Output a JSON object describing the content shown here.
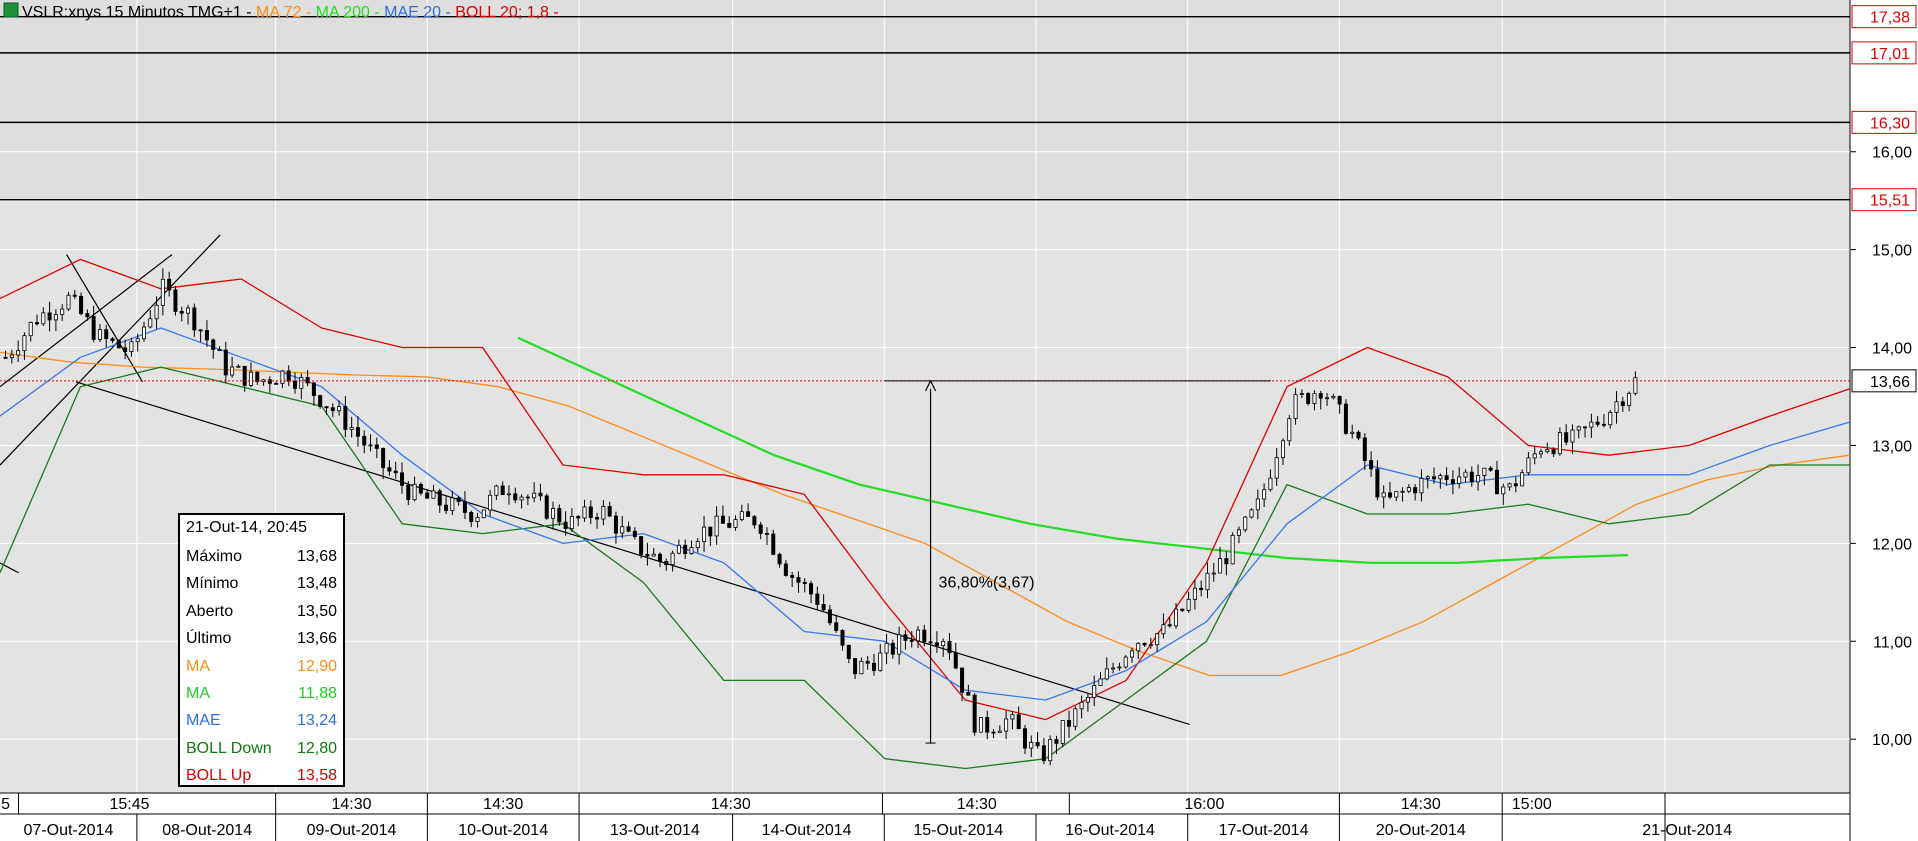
{
  "chart_data": {
    "type": "candlestick",
    "header": {
      "symbol": "VSLR:xnys 15 Minutos TMG+1",
      "separator": "-",
      "indicators": [
        {
          "label": "MA 72",
          "color": "#ff8c1a"
        },
        {
          "label": "MA 200",
          "color": "#22dd22"
        },
        {
          "label": "MAE 20",
          "color": "#2f6fe6"
        },
        {
          "label": "BOLL 20; 1,8",
          "color": "#e00000"
        }
      ]
    },
    "ylim": [
      9.45,
      17.55
    ],
    "y_ticks": [
      "10,00",
      "11,00",
      "12,00",
      "13,00",
      "14,00",
      "15,00",
      "16,00"
    ],
    "level_lines": [
      {
        "value": 17.38,
        "label": "17,38"
      },
      {
        "value": 17.01,
        "label": "17,01"
      },
      {
        "value": 16.3,
        "label": "16,30"
      },
      {
        "value": 15.51,
        "label": "15,51"
      }
    ],
    "current_price": {
      "value": 13.66,
      "label": "13,66",
      "color": "#e00000"
    },
    "x_time_labels": [
      {
        "slot": 0,
        "label": "5"
      },
      {
        "slot": 1,
        "label": "15:45"
      },
      {
        "slot": 2,
        "label": "14:30"
      },
      {
        "slot": 3,
        "label": "14:30"
      },
      {
        "slot": 4,
        "label": "14:30"
      },
      {
        "slot": 5,
        "label": "14:30"
      },
      {
        "slot": 6,
        "label": "16:00"
      },
      {
        "slot": 7,
        "label": "14:30"
      },
      {
        "slot": 8,
        "label": "15:00"
      }
    ],
    "x_date_labels": [
      "07-Out-2014",
      "08-Out-2014",
      "09-Out-2014",
      "10-Out-2014",
      "13-Out-2014",
      "14-Out-2014",
      "15-Out-2014",
      "16-Out-2014",
      "17-Out-2014",
      "20-Out-2014",
      "21-Out-2014"
    ],
    "close_series": [
      13.9,
      14.3,
      14.5,
      14.1,
      13.95,
      14.6,
      14.3,
      13.8,
      13.65,
      13.75,
      13.5,
      13.2,
      12.8,
      12.5,
      12.4,
      12.3,
      12.6,
      12.4,
      12.2,
      12.35,
      12.0,
      11.8,
      12.1,
      12.2,
      12.25,
      11.7,
      11.4,
      10.7,
      10.85,
      11.1,
      11.05,
      10.1,
      10.2,
      9.8,
      10.2,
      10.6,
      11.0,
      11.1,
      11.5,
      11.9,
      12.4,
      13.4,
      13.6,
      13.1,
      12.4,
      12.6,
      12.7,
      12.7,
      12.55,
      13.0,
      13.05,
      13.3,
      13.66
    ],
    "indicator_series": {
      "ma72": {
        "start": 0.0,
        "end": 1.0,
        "values": [
          13.95,
          13.85,
          13.8,
          13.78,
          13.75,
          13.72,
          13.7,
          13.6,
          13.4,
          13.1,
          12.8,
          12.5,
          12.25,
          12.0,
          11.6,
          11.2,
          10.9,
          10.65,
          10.65,
          10.9,
          11.2,
          11.6,
          12.0,
          12.4,
          12.65,
          12.8,
          12.9
        ]
      },
      "ma200": {
        "start": 0.28,
        "end": 0.88,
        "values": [
          14.1,
          13.7,
          13.3,
          12.9,
          12.6,
          12.4,
          12.2,
          12.05,
          11.95,
          11.85,
          11.8,
          11.8,
          11.85,
          11.88
        ]
      },
      "mae20": {
        "start": 0.0,
        "end": 1.0,
        "values": [
          13.3,
          13.9,
          14.2,
          13.9,
          13.6,
          12.9,
          12.3,
          12.0,
          12.1,
          11.8,
          11.1,
          11.0,
          10.5,
          10.4,
          10.7,
          11.2,
          12.2,
          12.8,
          12.6,
          12.7,
          12.7,
          12.7,
          13.0,
          13.24
        ]
      },
      "boll_up": {
        "start": 0.0,
        "end": 1.0,
        "values": [
          14.5,
          14.9,
          14.6,
          14.7,
          14.2,
          14.0,
          14.0,
          12.8,
          12.7,
          12.7,
          12.5,
          11.4,
          10.4,
          10.2,
          10.6,
          11.8,
          13.6,
          14.0,
          13.7,
          13.0,
          12.9,
          13.0,
          13.3,
          13.58
        ]
      },
      "boll_down": {
        "start": 0.0,
        "end": 1.0,
        "values": [
          11.7,
          13.6,
          13.8,
          13.6,
          13.4,
          12.2,
          12.1,
          12.2,
          11.6,
          10.6,
          10.6,
          9.8,
          9.7,
          9.8,
          10.4,
          11.0,
          12.6,
          12.3,
          12.3,
          12.4,
          12.2,
          12.3,
          12.8,
          12.8
        ]
      }
    },
    "annotation": {
      "text": "36,80%(3,67)",
      "from": 9.96,
      "to": 13.66
    },
    "ohlc_box": {
      "title": "21-Out-14, 20:45",
      "rows": [
        {
          "label": "Máximo",
          "value": "13,68",
          "color": "#000000"
        },
        {
          "label": "Mínimo",
          "value": "13,48",
          "color": "#000000"
        },
        {
          "label": "Aberto",
          "value": "13,50",
          "color": "#000000"
        },
        {
          "label": "Último",
          "value": "13,66",
          "color": "#000000"
        },
        {
          "label": "MA",
          "value": "12,90",
          "color": "#ff8c1a"
        },
        {
          "label": "MA",
          "value": "11,88",
          "color": "#22cc22"
        },
        {
          "label": "MAE",
          "value": "13,24",
          "color": "#2f6fe6"
        },
        {
          "label": "BOLL Down",
          "value": "12,80",
          "color": "#117711"
        },
        {
          "label": "BOLL Up",
          "value": "13,58",
          "color": "#e00000"
        }
      ]
    },
    "grid": true,
    "colors": {
      "plot_bg": "#e3e3e3",
      "upper_bg": "#dedede"
    }
  }
}
